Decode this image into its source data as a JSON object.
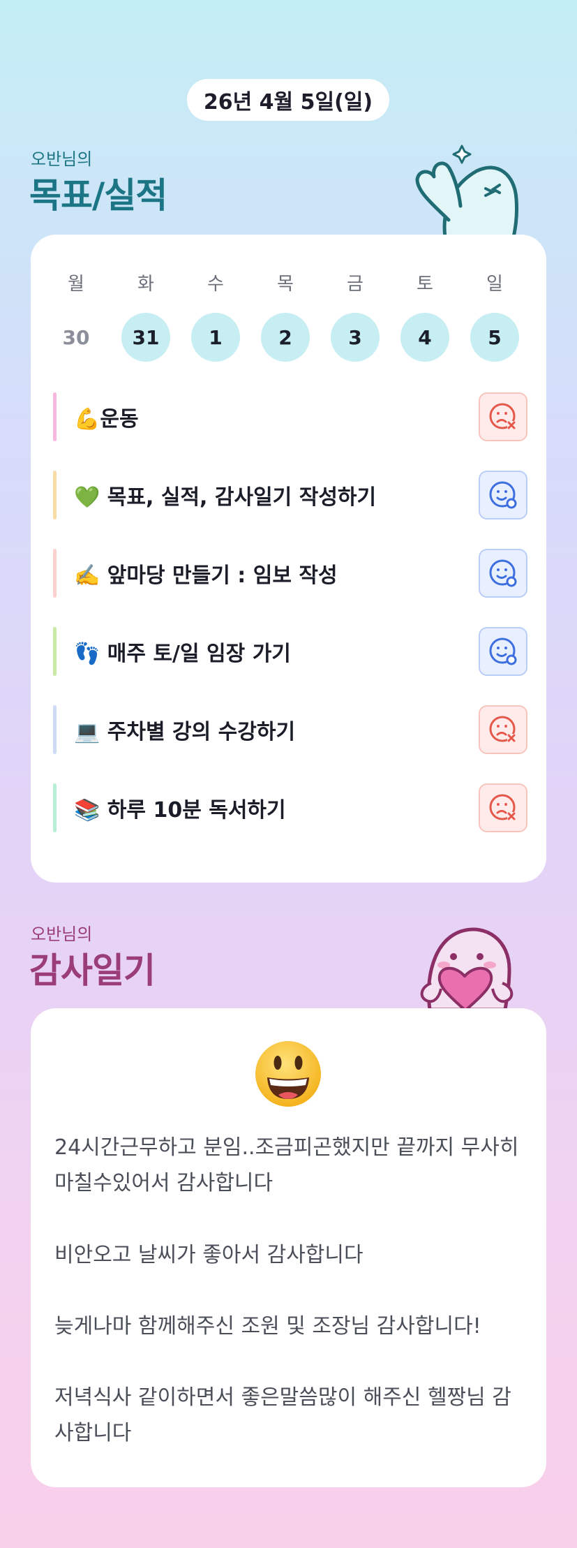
{
  "header": {
    "date": "26년 4월 5일(일)"
  },
  "goals_section": {
    "subtitle": "오반님의",
    "title": "목표/실적"
  },
  "week": [
    {
      "dow": "월",
      "date": "30",
      "active": false
    },
    {
      "dow": "화",
      "date": "31",
      "active": true
    },
    {
      "dow": "수",
      "date": "1",
      "active": true
    },
    {
      "dow": "목",
      "date": "2",
      "active": true
    },
    {
      "dow": "금",
      "date": "3",
      "active": true
    },
    {
      "dow": "토",
      "date": "4",
      "active": true
    },
    {
      "dow": "일",
      "date": "5",
      "active": true
    }
  ],
  "goals": [
    {
      "text": "💪운동",
      "status": "fail",
      "bar_color": "#f7b8df"
    },
    {
      "text": "💚 목표, 실적, 감사일기 작성하기",
      "status": "done",
      "bar_color": "#f9dba6"
    },
    {
      "text": "✍️ 앞마당 만들기 : 임보 작성",
      "status": "done",
      "bar_color": "#fdd0d0"
    },
    {
      "text": "👣 매주 토/일 임장 가기",
      "status": "done",
      "bar_color": "#c9eaa2"
    },
    {
      "text": "💻 주차별 강의 수강하기",
      "status": "fail",
      "bar_color": "#cfdaf5"
    },
    {
      "text": "📚 하루 10분 독서하기",
      "status": "fail",
      "bar_color": "#b7efd5"
    }
  ],
  "diary_section": {
    "subtitle": "오반님의",
    "title": "감사일기"
  },
  "diary": {
    "mood_icon": "grinning-face-icon",
    "paragraphs": [
      "24시간근무하고 분임..조금피곤했지만 끝까지 무사히 마칠수있어서 감사합니다",
      "비안오고 날씨가 좋아서 감사합니다",
      "늦게나마 함께해주신 조원 및 조장님 감사합니다!",
      "저녁식사 같이하면서 좋은말씀많이 해주신 헬짱님 감사합니다"
    ]
  },
  "colors": {
    "teal_title": "#1c7585",
    "plum_title": "#9b3d78",
    "done_icon": "#3d6ee0",
    "fail_icon": "#e5574a",
    "active_date_bg": "#c7eef2"
  }
}
